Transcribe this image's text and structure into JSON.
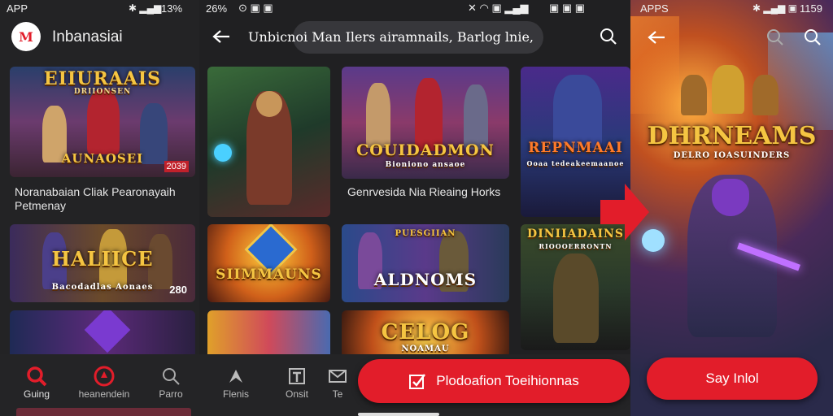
{
  "colors": {
    "accent": "#e21d2a",
    "background": "#202022",
    "text": "#ffffff"
  },
  "left": {
    "status": {
      "carrier": "APP",
      "battery": "13%",
      "signal": "26%"
    },
    "app_title": "Inbanasiai",
    "cards": [
      {
        "title": "EIIURAAIS",
        "subtitle": "DRIIONSEN",
        "banner": "AUNAOSEI",
        "badge": "2039",
        "caption": "Noranabaian Cliak Pearonayaih Petmenay"
      },
      {
        "title": "HALIICE",
        "subtitle": "Bacodadlas Aonaes",
        "badge": "280"
      }
    ],
    "nav": [
      {
        "icon": "search-icon",
        "label": "Guing"
      },
      {
        "icon": "compass-icon",
        "label": "heanendein"
      },
      {
        "icon": "search-icon",
        "label": "Parro"
      }
    ]
  },
  "middle": {
    "search_text": "Unbicnoi Man Ilers airamnails, Barlog lnie,",
    "cards": [
      {
        "title": "",
        "caption": ""
      },
      {
        "title": "COUIDADMON",
        "subtitle": "Bioniono ansaoe",
        "caption": "Genrvesida Nia Rieaing Horks"
      },
      {
        "title": "REPNMAAI",
        "subtitle": "Ooaa tedeakeemaanoe"
      },
      {
        "title": "SIIMMAUNS"
      },
      {
        "title": "ALDNOMS",
        "subtitle": "PUESGIIAN"
      },
      {
        "title": "DINIIADAINS",
        "subtitle": "RIOOOERRONTN"
      },
      {
        "title": ""
      },
      {
        "title": "CELOG",
        "subtitle": "NOAMAU"
      }
    ],
    "nav": [
      {
        "icon": "arrow-up-icon",
        "label": "Flenis"
      },
      {
        "icon": "text-icon",
        "label": "Onsit"
      },
      {
        "icon": "mail-icon",
        "label": "Te"
      }
    ],
    "cta_label": "Plodoafion Toeihionnas"
  },
  "right": {
    "status": {
      "carrier": "APPS",
      "battery": "1159"
    },
    "title": "DHRNEAMS",
    "subtitle": "DELRO IOASUINDERS",
    "cta_label": "Say Inlol"
  }
}
